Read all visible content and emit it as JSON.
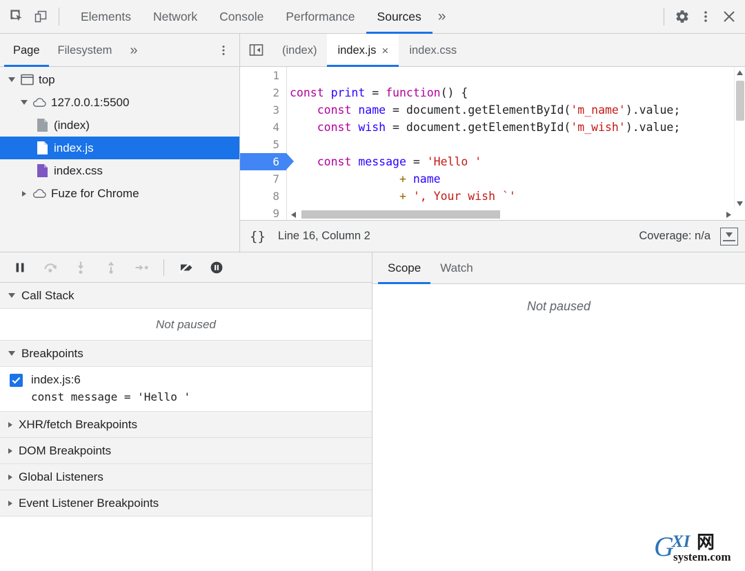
{
  "toolbar": {
    "inspect_icon": "inspect-cursor-icon",
    "device_icon": "device-toolbar-icon",
    "panels": [
      {
        "label": "Elements",
        "selected": false
      },
      {
        "label": "Network",
        "selected": false
      },
      {
        "label": "Console",
        "selected": false
      },
      {
        "label": "Performance",
        "selected": false
      },
      {
        "label": "Sources",
        "selected": true
      }
    ],
    "more_panels": "»",
    "settings_icon": "gear-icon",
    "menu_icon": "kebab-menu-icon",
    "close_icon": "close-icon"
  },
  "navigator": {
    "tabs": [
      {
        "label": "Page",
        "selected": true
      },
      {
        "label": "Filesystem",
        "selected": false
      }
    ],
    "more": "»",
    "kebab": "more-options-icon",
    "tree": [
      {
        "label": "top",
        "indent": 0,
        "twisty": "open",
        "icon": "frame-icon",
        "selected": false
      },
      {
        "label": "127.0.0.1:5500",
        "indent": 1,
        "twisty": "open",
        "icon": "cloud-icon",
        "selected": false
      },
      {
        "label": "(index)",
        "indent": 2,
        "twisty": "none",
        "icon": "document-icon",
        "selected": false
      },
      {
        "label": "index.js",
        "indent": 2,
        "twisty": "none",
        "icon": "script-icon",
        "selected": true
      },
      {
        "label": "index.css",
        "indent": 2,
        "twisty": "none",
        "icon": "stylesheet-icon",
        "selected": false
      },
      {
        "label": "Fuze for Chrome",
        "indent": 1,
        "twisty": "closed",
        "icon": "cloud-icon",
        "selected": false
      }
    ]
  },
  "editor": {
    "collapse_icon": "collapse-navigator-icon",
    "tabs": [
      {
        "label": "(index)",
        "selected": false,
        "closable": false
      },
      {
        "label": "index.js",
        "selected": true,
        "closable": true
      },
      {
        "label": "index.css",
        "selected": false,
        "closable": false
      }
    ],
    "close_glyph": "×",
    "line_numbers": [
      "1",
      "2",
      "3",
      "4",
      "5",
      "6",
      "7",
      "8",
      "9"
    ],
    "breakpoint_line": "6",
    "code_lines": [
      {
        "n": "1",
        "tokens": []
      },
      {
        "n": "2",
        "tokens": [
          {
            "t": "const",
            "c": "k-kw"
          },
          {
            "t": " ",
            "c": "k-pl"
          },
          {
            "t": "print",
            "c": "k-fn"
          },
          {
            "t": " = ",
            "c": "k-pl"
          },
          {
            "t": "function",
            "c": "k-kw"
          },
          {
            "t": "() {",
            "c": "k-pl"
          }
        ]
      },
      {
        "n": "3",
        "tokens": [
          {
            "t": "    ",
            "c": "k-pl"
          },
          {
            "t": "const",
            "c": "k-kw"
          },
          {
            "t": " ",
            "c": "k-pl"
          },
          {
            "t": "name",
            "c": "k-fn"
          },
          {
            "t": " = document.getElementById(",
            "c": "k-pl"
          },
          {
            "t": "'m_name'",
            "c": "k-str"
          },
          {
            "t": ").value;",
            "c": "k-pl"
          }
        ]
      },
      {
        "n": "4",
        "tokens": [
          {
            "t": "    ",
            "c": "k-pl"
          },
          {
            "t": "const",
            "c": "k-kw"
          },
          {
            "t": " ",
            "c": "k-pl"
          },
          {
            "t": "wish",
            "c": "k-fn"
          },
          {
            "t": " = document.getElementById(",
            "c": "k-pl"
          },
          {
            "t": "'m_wish'",
            "c": "k-str"
          },
          {
            "t": ").value;",
            "c": "k-pl"
          }
        ]
      },
      {
        "n": "5",
        "tokens": []
      },
      {
        "n": "6",
        "tokens": [
          {
            "t": "    ",
            "c": "k-pl"
          },
          {
            "t": "const",
            "c": "k-kw"
          },
          {
            "t": " ",
            "c": "k-pl"
          },
          {
            "t": "message",
            "c": "k-fn"
          },
          {
            "t": " = ",
            "c": "k-pl"
          },
          {
            "t": "'Hello '",
            "c": "k-str"
          }
        ]
      },
      {
        "n": "7",
        "tokens": [
          {
            "t": "                ",
            "c": "k-pl"
          },
          {
            "t": "+",
            "c": "k-op"
          },
          {
            "t": " ",
            "c": "k-pl"
          },
          {
            "t": "name",
            "c": "k-var"
          }
        ]
      },
      {
        "n": "8",
        "tokens": [
          {
            "t": "                ",
            "c": "k-pl"
          },
          {
            "t": "+",
            "c": "k-op"
          },
          {
            "t": " ",
            "c": "k-pl"
          },
          {
            "t": "', Your wish `'",
            "c": "k-str"
          }
        ]
      },
      {
        "n": "9",
        "tokens": []
      }
    ],
    "status": {
      "pretty_print": "{}",
      "cursor_position": "Line 16, Column 2",
      "coverage": "Coverage: n/a",
      "drawer_icon": "show-drawer-icon"
    }
  },
  "debugger": {
    "controls": [
      {
        "name": "resume-pause-script-button",
        "icon": "pause-icon",
        "enabled": true
      },
      {
        "name": "step-over-button",
        "icon": "step-over-icon",
        "enabled": false
      },
      {
        "name": "step-into-button",
        "icon": "step-into-icon",
        "enabled": false
      },
      {
        "name": "step-out-button",
        "icon": "step-out-icon",
        "enabled": false
      },
      {
        "name": "step-button",
        "icon": "step-icon",
        "enabled": false
      },
      {
        "name": "deactivate-breakpoints-button",
        "icon": "deactivate-breakpoints-icon",
        "enabled": true
      },
      {
        "name": "pause-on-exceptions-button",
        "icon": "pause-on-exceptions-icon",
        "enabled": true
      }
    ],
    "call_stack": {
      "title": "Call Stack",
      "expanded": true,
      "empty_message": "Not paused"
    },
    "breakpoints": {
      "title": "Breakpoints",
      "expanded": true,
      "items": [
        {
          "location": "index.js:6",
          "snippet": "const message = 'Hello '",
          "checked": true
        }
      ]
    },
    "sections": [
      {
        "title": "XHR/fetch Breakpoints",
        "expanded": false
      },
      {
        "title": "DOM Breakpoints",
        "expanded": false
      },
      {
        "title": "Global Listeners",
        "expanded": false
      },
      {
        "title": "Event Listener Breakpoints",
        "expanded": false
      }
    ]
  },
  "scope_pane": {
    "tabs": [
      {
        "label": "Scope",
        "selected": true
      },
      {
        "label": "Watch",
        "selected": false
      }
    ],
    "empty_message": "Not paused"
  },
  "watermark": {
    "part1": "G",
    "part2": "XI",
    "part3": "网",
    "part4": "system.com"
  },
  "colors": {
    "accent": "#1a73e8",
    "toolbar_bg": "#f3f3f3",
    "border": "#cdcdcd",
    "selection": "#1a73e8",
    "text": "#202124",
    "muted_text": "#5f6368",
    "keyword": "#b1009a",
    "string": "#c41a16",
    "identifier": "#2a00ff",
    "operator": "#9c6500",
    "breakpoint": "#4285f4"
  }
}
